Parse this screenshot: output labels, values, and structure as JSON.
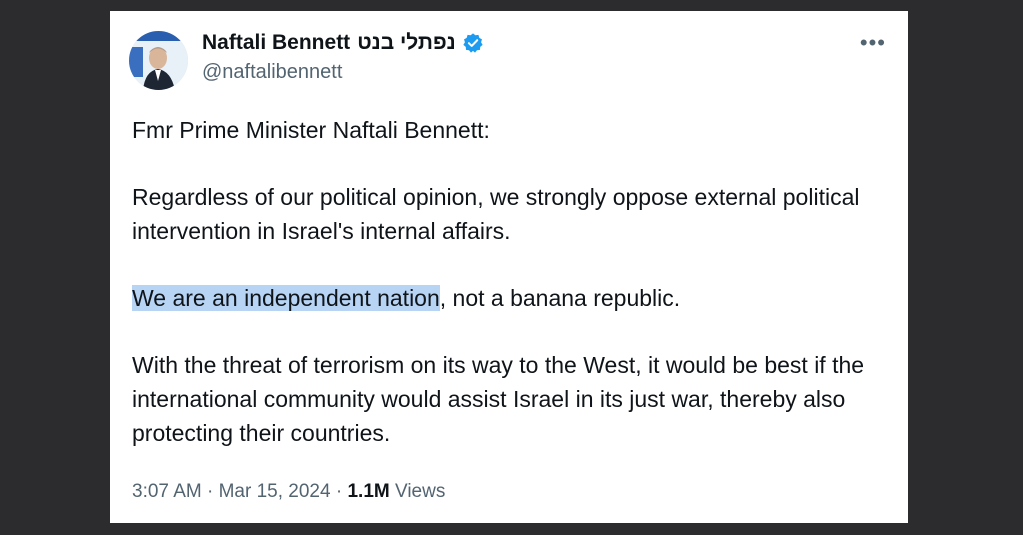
{
  "author": {
    "display_name": "Naftali Bennett",
    "hebrew_name": "נפתלי בנט",
    "handle": "@naftalibennett",
    "verified_icon": "verified-badge-icon",
    "avatar_icon": "profile-photo"
  },
  "more_label": "•••",
  "tweet": {
    "line1": "Fmr Prime Minister Naftali Bennett:",
    "para2": "Regardless of our political opinion, we strongly oppose external political intervention in Israel's internal affairs.",
    "para3_highlight": "We are an independent nation",
    "para3_rest": ", not a banana republic.",
    "para4": "With the threat of terrorism on its way to the West, it would be best if the international community would assist Israel in its just war, thereby also protecting their countries."
  },
  "meta": {
    "time": "3:07 AM",
    "sep1": " · ",
    "date": "Mar 15, 2024",
    "sep2": " · ",
    "views_count": "1.1M",
    "views_label": " Views"
  },
  "colors": {
    "highlight": "#b8d4f5",
    "verified": "#1d9bf0",
    "secondary_text": "#536471"
  }
}
